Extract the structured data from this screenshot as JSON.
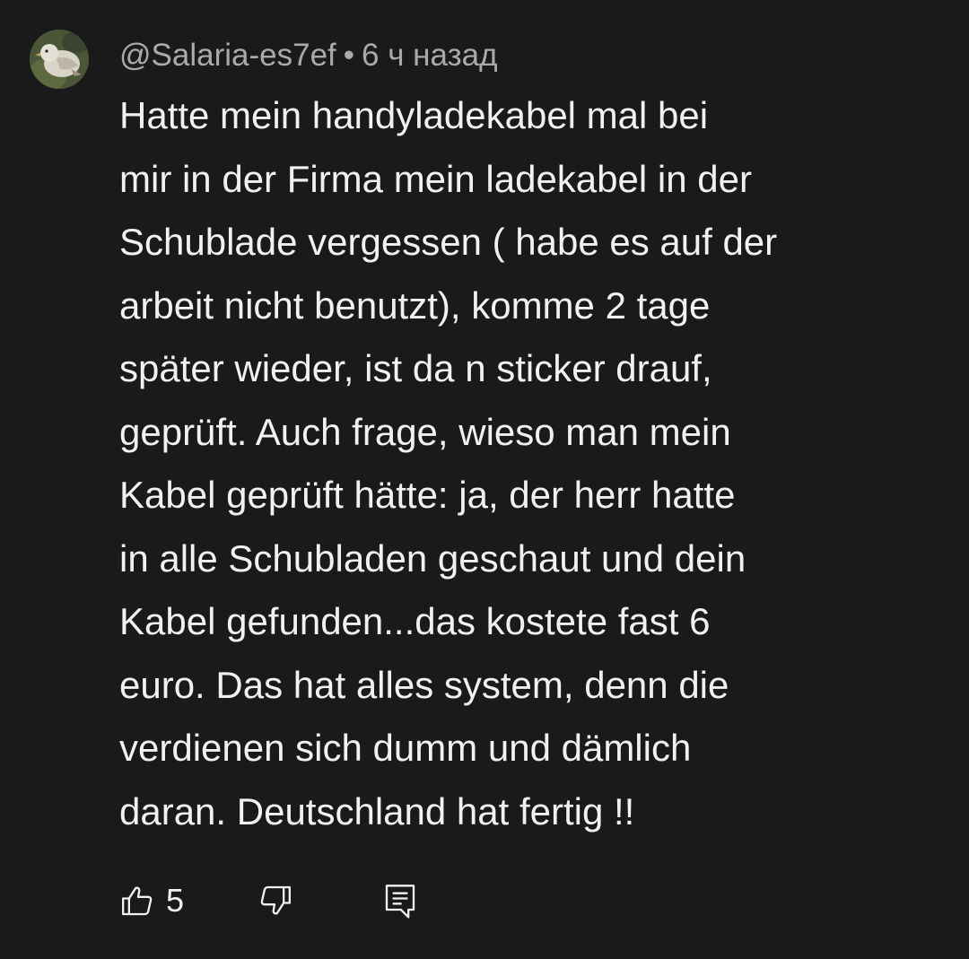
{
  "comment": {
    "author": "@Salaria-es7ef",
    "separator": "•",
    "time": "6 ч назад",
    "lines": [
      "Hatte mein handyladekabel mal bei",
      "mir in der Firma mein ladekabel in der",
      "Schublade vergessen ( habe es auf der",
      "arbeit nicht benutzt), komme 2 tage",
      "später wieder, ist da n sticker drauf,",
      "geprüft. Auch frage, wieso man mein",
      "Kabel geprüft hätte: ja, der herr hatte",
      "in alle Schubladen geschaut und dein",
      "Kabel gefunden...das kostete fast 6",
      "euro. Das hat alles system, denn die",
      "verdienen sich dumm und dämlich",
      "daran. Deutschland hat fertig !!"
    ],
    "likes": "5"
  },
  "icons": {
    "like": "thumbs-up-icon",
    "dislike": "thumbs-down-icon",
    "reply": "reply-comment-icon",
    "avatar": "avatar-bird-photo"
  },
  "colors": {
    "background": "#1a1a1a",
    "text": "#f1f1f1",
    "meta": "#aaaaaa"
  }
}
